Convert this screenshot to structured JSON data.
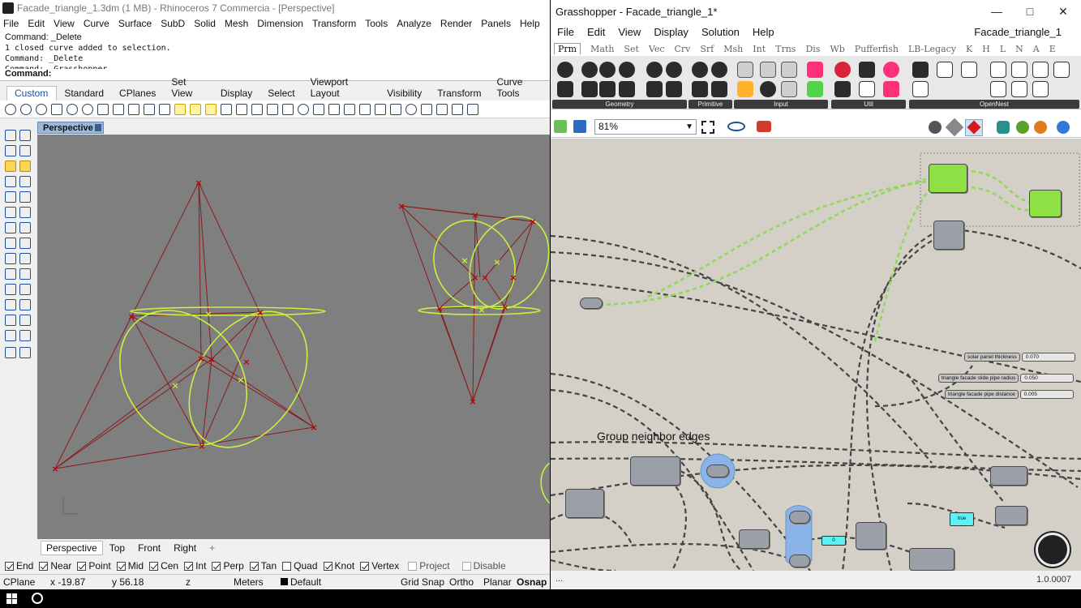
{
  "rhino": {
    "title": "Facade_triangle_1.3dm (1 MB) - Rhinoceros 7 Commercia - [Perspective]",
    "menu": [
      "File",
      "Edit",
      "View",
      "Curve",
      "Surface",
      "SubD",
      "Solid",
      "Mesh",
      "Dimension",
      "Transform",
      "Tools",
      "Analyze",
      "Render",
      "Panels",
      "Help"
    ],
    "command_history": [
      "Command: _Delete",
      "1 closed curve added to selection.",
      "Command: _Delete",
      "Command: _Grasshopper"
    ],
    "command_prompt": "Command:",
    "toolbar_tabs": [
      "Custom",
      "Standard",
      "CPlanes",
      "Set View",
      "Display",
      "Select",
      "Viewport Layout",
      "Visibility",
      "Transform",
      "Curve Tools"
    ],
    "active_tab": "Custom",
    "viewport_name": "Perspective",
    "viewport_tabs": [
      "Perspective",
      "Top",
      "Front",
      "Right"
    ],
    "viewport_add": "+",
    "osnaps": [
      {
        "label": "End",
        "checked": true
      },
      {
        "label": "Near",
        "checked": true
      },
      {
        "label": "Point",
        "checked": true
      },
      {
        "label": "Mid",
        "checked": true
      },
      {
        "label": "Cen",
        "checked": true
      },
      {
        "label": "Int",
        "checked": true
      },
      {
        "label": "Perp",
        "checked": true
      },
      {
        "label": "Tan",
        "checked": true
      },
      {
        "label": "Quad",
        "checked": false
      },
      {
        "label": "Knot",
        "checked": true
      },
      {
        "label": "Vertex",
        "checked": true
      },
      {
        "label": "Project",
        "checked": false
      },
      {
        "label": "Disable",
        "checked": false
      }
    ],
    "status": {
      "cplane": "CPlane",
      "x": "x -19.87",
      "y": "y 56.18",
      "z": "z",
      "units": "Meters",
      "layer": "Default",
      "grid_snap": "Grid Snap",
      "ortho": "Ortho",
      "planar": "Planar",
      "osnap": "Osnap"
    },
    "colors": {
      "curve": "#8b1a1a",
      "control_point": "#c00000",
      "selected": "#c8f03c",
      "viewport_bg": "#7f7f7f"
    }
  },
  "gh": {
    "title": "Grasshopper - Facade_triangle_1*",
    "menu": [
      "File",
      "Edit",
      "View",
      "Display",
      "Solution",
      "Help"
    ],
    "document": "Facade_triangle_1",
    "tabs": [
      "Prm",
      "Math",
      "Set",
      "Vec",
      "Crv",
      "Srf",
      "Msh",
      "Int",
      "Trns",
      "Dis",
      "Wb",
      "Pufferfish",
      "LB-Legacy",
      "K",
      "H",
      "L",
      "N",
      "A",
      "E"
    ],
    "active_tab": "Prm",
    "panels": [
      "Geometry",
      "Primitive",
      "Input",
      "Util",
      "OpenNest"
    ],
    "zoom": "81%",
    "group_title": "Group neighbor edges",
    "sliders": [
      {
        "label": "solar panel thickness",
        "value": "0.070"
      },
      {
        "label": "triangle facade slide pipe radius",
        "value": "0.050"
      },
      {
        "label": "triangle facade pipe distance",
        "value": "0.005"
      }
    ],
    "boolean_toggle": "true",
    "number_param": "0",
    "status_dots": "...",
    "version": "1.0.0007",
    "colors": {
      "canvas": "#d4d0c8",
      "component": "#9a9fa8",
      "selected_component": "#8fe045",
      "wire": "#444444",
      "wire_selected": "#90d85a"
    }
  }
}
